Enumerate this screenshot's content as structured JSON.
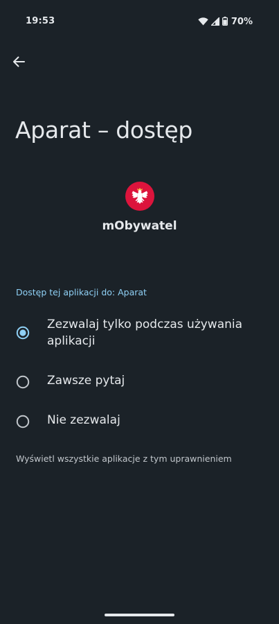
{
  "status_bar": {
    "time": "19:53",
    "battery": "70%"
  },
  "header": {
    "title": "Aparat – dostęp"
  },
  "app": {
    "name": "mObywatel",
    "icon_color": "#dc143c"
  },
  "section": {
    "header": "Dostęp tej aplikacji do: Aparat"
  },
  "options": [
    {
      "label": "Zezwalaj tylko podczas używania aplikacji",
      "selected": true
    },
    {
      "label": "Zawsze pytaj",
      "selected": false
    },
    {
      "label": "Nie zezwalaj",
      "selected": false
    }
  ],
  "footer": {
    "link": "Wyświetl wszystkie aplikacje z tym uprawnieniem"
  },
  "colors": {
    "background": "#1b2228",
    "accent": "#8fd0f5",
    "text": "#e6e9ec"
  }
}
